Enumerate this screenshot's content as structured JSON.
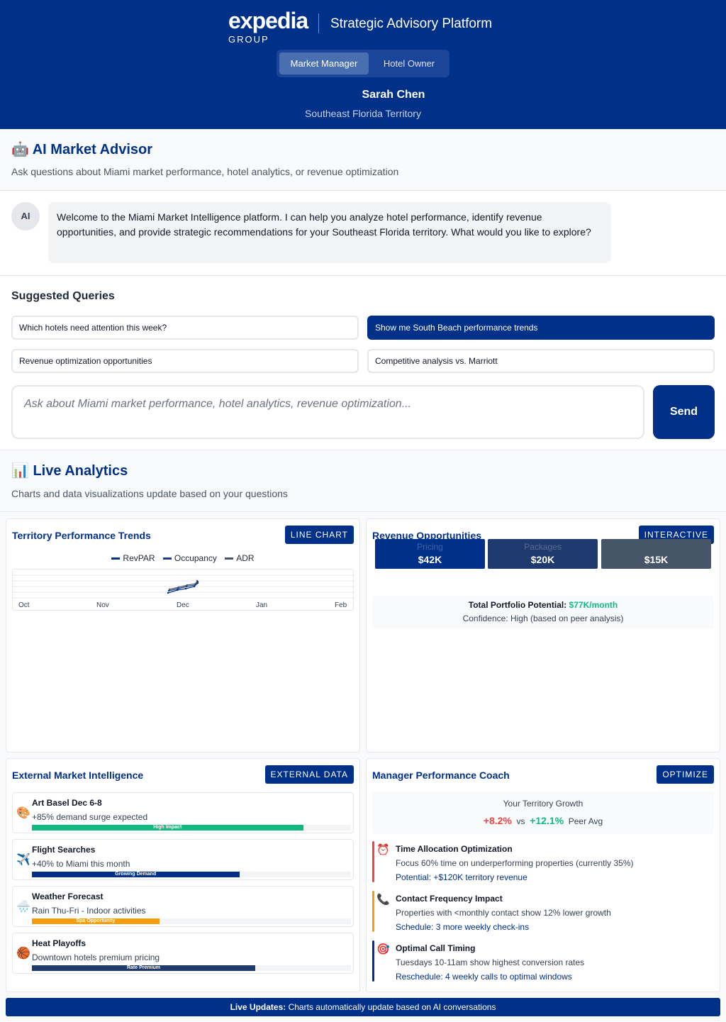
{
  "header": {
    "logo_word": "expedia",
    "logo_group": "GROUP",
    "platform_title": "Strategic Advisory Platform",
    "roles": [
      "Market Manager",
      "Hotel Owner"
    ],
    "active_role": "Market Manager",
    "user_name": "Sarah Chen",
    "territory": "Southeast Florida Territory",
    "brand_color": "#003087"
  },
  "advisor": {
    "icon": "robot-icon",
    "icon_glyph": "🤖",
    "title": "AI Market Advisor",
    "subtitle": "Ask questions about Miami market performance, hotel analytics, or revenue optimization"
  },
  "chat": {
    "avatar": "AI",
    "message": "Welcome to the Miami Market Intelligence platform. I can help you analyze hotel performance, identify revenue opportunities, and provide strategic recommendations for your Southeast Florida territory. What would you like to explore?"
  },
  "suggestions": {
    "title": "Suggested Queries",
    "items": [
      "Which hotels need attention this week?",
      "Show me South Beach performance trends",
      "Revenue optimization opportunities",
      "Competitive analysis vs. Marriott"
    ],
    "active_index": 1
  },
  "query": {
    "placeholder": "Ask about Miami market performance, hotel analytics, revenue optimization...",
    "send_label": "Send"
  },
  "analytics": {
    "icon": "bar-chart-icon",
    "icon_glyph": "📊",
    "title": "Live Analytics",
    "subtitle": "Charts and data visualizations update based on your questions"
  },
  "trends_card": {
    "title": "Territory Performance Trends",
    "badge": "LINE CHART"
  },
  "chart_data": {
    "type": "line",
    "title": "Territory Performance Trends",
    "x": [
      "Oct",
      "Nov",
      "Dec",
      "Jan",
      "Feb"
    ],
    "series": [
      {
        "name": "RevPAR",
        "color": "#003087"
      },
      {
        "name": "Occupancy",
        "color": "#1e3a8a"
      },
      {
        "name": "ADR",
        "color": "#475569"
      }
    ],
    "grid": true,
    "legend": "top-center"
  },
  "opportunities_card": {
    "title": "Revenue Opportunities",
    "badge": "INTERACTIVE",
    "items": [
      {
        "label": "Pricing",
        "value": "$42K",
        "color": "#003087"
      },
      {
        "label": "Packages",
        "value": "$20K",
        "color": "#1e3a6e"
      },
      {
        "label": "",
        "value": "$15K",
        "color": "#475569"
      }
    ],
    "total_label": "Total Portfolio Potential:",
    "total_value": "$77K/month",
    "confidence": "Confidence: High (based on peer analysis)"
  },
  "intel_card": {
    "title": "External Market Intelligence",
    "badge": "EXTERNAL DATA",
    "items": [
      {
        "icon": "palette-icon",
        "glyph": "🎨",
        "title": "Art Basel Dec 6-8",
        "desc": "+85% demand surge expected",
        "tag": "High Impact",
        "level": 0.85,
        "color": "#10b981"
      },
      {
        "icon": "airplane-icon",
        "glyph": "✈️",
        "title": "Flight Searches",
        "desc": "+40% to Miami this month",
        "tag": "Growing Demand",
        "level": 0.65,
        "color": "#003087"
      },
      {
        "icon": "rain-cloud-icon",
        "glyph": "🌧️",
        "title": "Weather Forecast",
        "desc": "Rain Thu-Fri - Indoor activities",
        "tag": "Spa Opportunity",
        "level": 0.4,
        "color": "#f59e0b"
      },
      {
        "icon": "basketball-icon",
        "glyph": "🏀",
        "title": "Heat Playoffs",
        "desc": "Downtown hotels premium pricing",
        "tag": "Rate Premium",
        "level": 0.7,
        "color": "#1e3a6e"
      }
    ]
  },
  "coach_card": {
    "title": "Manager Performance Coach",
    "badge": "OPTIMIZE",
    "growth_label": "Your Territory Growth",
    "my_growth": "+8.2%",
    "vs": "vs",
    "peer_growth": "+12.1%",
    "peer_label": "Peer Avg",
    "items": [
      {
        "icon": "alarm-clock-icon",
        "glyph": "⏰",
        "title": "Time Allocation Optimization",
        "desc": "Focus 60% time on underperforming properties (currently 35%)",
        "action": "Potential: +$120K territory revenue",
        "color": "#ef4444"
      },
      {
        "icon": "phone-icon",
        "glyph": "📞",
        "title": "Contact Frequency Impact",
        "desc": "Properties with <monthly contact show 12% lower growth",
        "action": "Schedule: 3 more weekly check-ins",
        "color": "#f59e0b"
      },
      {
        "icon": "target-icon",
        "glyph": "🎯",
        "title": "Optimal Call Timing",
        "desc": "Tuesdays 10-11am show highest conversion rates",
        "action": "Reschedule: 4 weekly calls to optimal windows",
        "color": "#003087"
      }
    ]
  },
  "footer": {
    "label": "Live Updates:",
    "text": "Charts automatically update based on AI conversations"
  }
}
